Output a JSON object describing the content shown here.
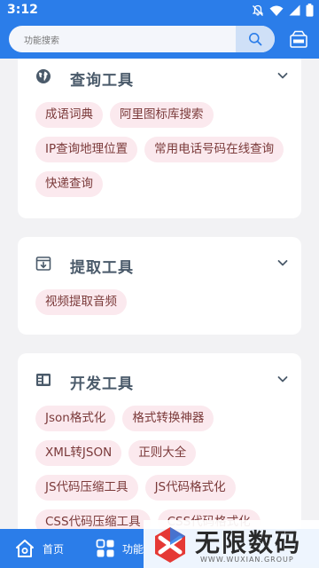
{
  "status_bar": {
    "time": "3:12"
  },
  "search": {
    "placeholder": "功能搜索"
  },
  "cards": [
    {
      "title": "查询工具",
      "icon": "globe-icon",
      "tags": [
        "成语词典",
        "阿里图标库搜索",
        "IP查询地理位置",
        "常用电话号码在线查询",
        "快递查询"
      ]
    },
    {
      "title": "提取工具",
      "icon": "download-box-icon",
      "tags": [
        "视频提取音频"
      ]
    },
    {
      "title": "开发工具",
      "icon": "code-panel-icon",
      "tags": [
        "Json格式化",
        "格式转换神器",
        "XML转JSON",
        "正则大全",
        "JS代码压缩工具",
        "JS代码格式化",
        "CSS代码压缩工具",
        "CSS代码格式化"
      ]
    }
  ],
  "bottom_nav": {
    "home_label": "首页",
    "func_label": "功能"
  },
  "watermark": {
    "title": "无限数码",
    "subtitle": "WWW.WUXIAN.GROUP"
  },
  "colors": {
    "primary": "#2b7de9",
    "tag_bg": "#fbe9ee",
    "tag_text": "#7b3a3a",
    "card_title": "#4a5a6a"
  }
}
